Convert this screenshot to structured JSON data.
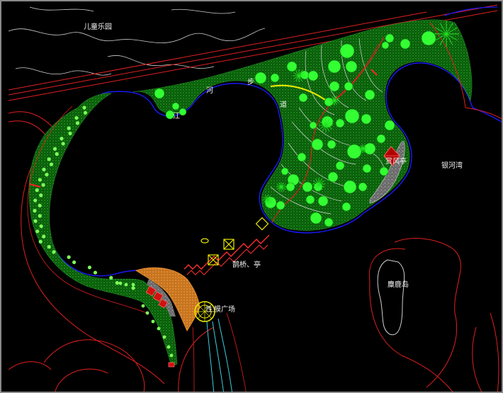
{
  "labels": {
    "children_park": "儿童乐园",
    "path_he": "河",
    "path_bu": "步",
    "path_dao": "道",
    "path_jiang": "江",
    "wind_pavilion": "赏风亭",
    "galaxy_bay": "银河湾",
    "magpie_bridge": "鹊桥、亭",
    "deer_island": "麋鹿岛",
    "membrane_plaza": "膜广场",
    "plaza_prefix": "性"
  },
  "colors": {
    "background": "#000000",
    "road_red": "#e02020",
    "water_blue": "#1a1aff",
    "grass_green": "#0a7a0a",
    "tree_green": "#33ff33",
    "contour_white": "#cfcfcf",
    "plaza_orange": "#e08a30",
    "pavilion_yellow": "#e8e800",
    "bridge_red": "#ff3030"
  }
}
